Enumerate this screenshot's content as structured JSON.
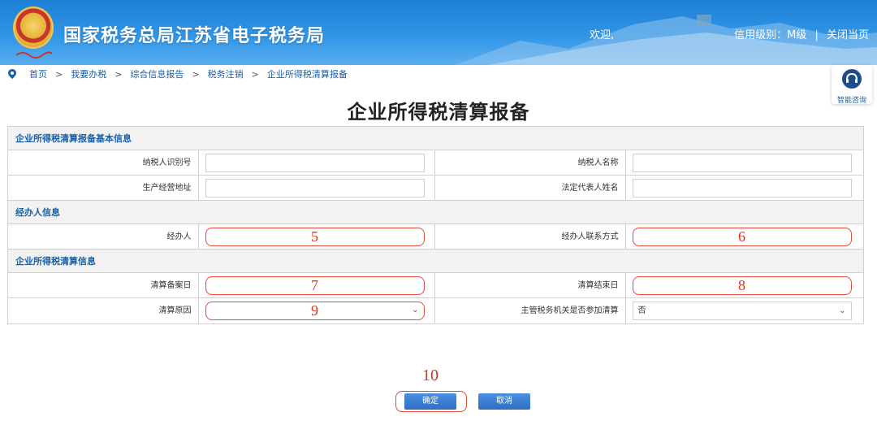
{
  "header": {
    "site_title": "国家税务总局江苏省电子税务局",
    "welcome": "欢迎,",
    "credit_level": "信用级别：M级",
    "separator": "|",
    "close_page": "关闭当页"
  },
  "breadcrumb": {
    "items": [
      "首页",
      "我要办税",
      "综合信息报告",
      "税务注销",
      "企业所得税清算报备"
    ],
    "separator": ">"
  },
  "consult": {
    "label": "智能咨询"
  },
  "page_title": "企业所得税清算报备",
  "sections": {
    "basic": "企业所得税清算报备基本信息",
    "handler": "经办人信息",
    "liquidation": "企业所得税清算信息"
  },
  "fields": {
    "taxpayer_id_label": "纳税人识别号",
    "taxpayer_id_value": "",
    "taxpayer_name_label": "纳税人名称",
    "taxpayer_name_value": "",
    "business_address_label": "生产经营地址",
    "business_address_value": "",
    "legal_rep_label": "法定代表人姓名",
    "legal_rep_value": "",
    "handler_label": "经办人",
    "handler_marker": "5",
    "handler_contact_label": "经办人联系方式",
    "handler_contact_marker": "6",
    "filing_date_label": "清算备案日",
    "filing_date_marker": "7",
    "end_date_label": "清算结束日",
    "end_date_marker": "8",
    "reason_label": "清算原因",
    "reason_marker": "9",
    "tax_authority_label": "主管税务机关是否参加清算",
    "tax_authority_value": "否"
  },
  "actions": {
    "confirm_marker": "10",
    "confirm_label": "确定",
    "cancel_label": "取消"
  },
  "colors": {
    "banner": "#2f95e6",
    "link": "#1a5fa8",
    "highlight": "#e04a3a",
    "button": "#3a80d6"
  }
}
